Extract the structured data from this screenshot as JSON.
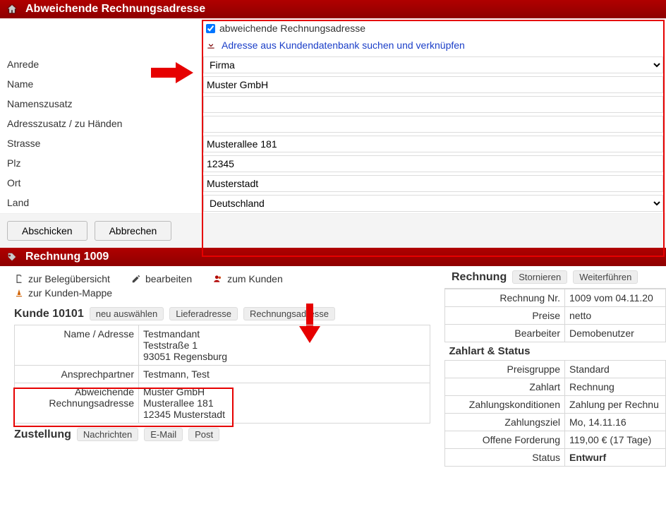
{
  "header": {
    "title": "Abweichende Rechnungsadresse"
  },
  "form": {
    "checkbox_label": "abweichende Rechnungsadresse",
    "search_link": "Adresse aus Kundendatenbank suchen und verknüpfen",
    "labels": {
      "anrede": "Anrede",
      "name": "Name",
      "namenszusatz": "Namenszusatz",
      "adresszusatz": "Adresszusatz / zu Händen",
      "strasse": "Strasse",
      "plz": "Plz",
      "ort": "Ort",
      "land": "Land"
    },
    "values": {
      "anrede": "Firma",
      "name": "Muster GmbH",
      "namenszusatz": "",
      "adresszusatz": "",
      "strasse": "Musterallee 181",
      "plz": "12345",
      "ort": "Musterstadt",
      "land": "Deutschland"
    },
    "buttons": {
      "submit": "Abschicken",
      "cancel": "Abbrechen"
    }
  },
  "lower": {
    "header": "Rechnung 1009",
    "toolbar": {
      "beleguebersicht": "zur Belegübersicht",
      "bearbeiten": "bearbeiten",
      "zum_kunden": "zum Kunden",
      "kunden_mappe": "zur Kunden-Mappe"
    },
    "kunde": {
      "title": "Kunde 10101",
      "pills": {
        "neu": "neu auswählen",
        "liefer": "Lieferadresse",
        "rechnung": "Rechnungsadresse"
      },
      "rows": {
        "name_adresse_label": "Name / Adresse",
        "name_adresse_value": "Testmandant\nTeststraße 1\n93051 Regensburg",
        "ansprechpartner_label": "Ansprechpartner",
        "ansprechpartner_value": "Testmann, Test",
        "abw_label": "Abweichende Rechnungsadresse",
        "abw_value": "Muster GmbH\nMusterallee 181\n12345 Musterstadt"
      }
    },
    "zustellung": {
      "title": "Zustellung",
      "pills": {
        "nachrichten": "Nachrichten",
        "email": "E-Mail",
        "post": "Post"
      }
    },
    "right": {
      "rechnung_head": "Rechnung",
      "stornieren": "Stornieren",
      "weiterfuehren": "Weiterführen",
      "rows": {
        "rechnung_nr_label": "Rechnung Nr.",
        "rechnung_nr_value": "1009 vom 04.11.20",
        "preise_label": "Preise",
        "preise_value": "netto",
        "bearbeiter_label": "Bearbeiter",
        "bearbeiter_value": "Demobenutzer"
      },
      "zahl_head": "Zahlart & Status",
      "zrows": {
        "preisgruppe_label": "Preisgruppe",
        "preisgruppe_value": "Standard",
        "zahlart_label": "Zahlart",
        "zahlart_value": "Rechnung",
        "konditionen_label": "Zahlungskonditionen",
        "konditionen_value": "Zahlung per Rechnu",
        "ziel_label": "Zahlungsziel",
        "ziel_value": "Mo, 14.11.16",
        "offene_label": "Offene Forderung",
        "offene_value": "119,00 € (17 Tage)",
        "status_label": "Status",
        "status_value": "Entwurf"
      }
    }
  }
}
